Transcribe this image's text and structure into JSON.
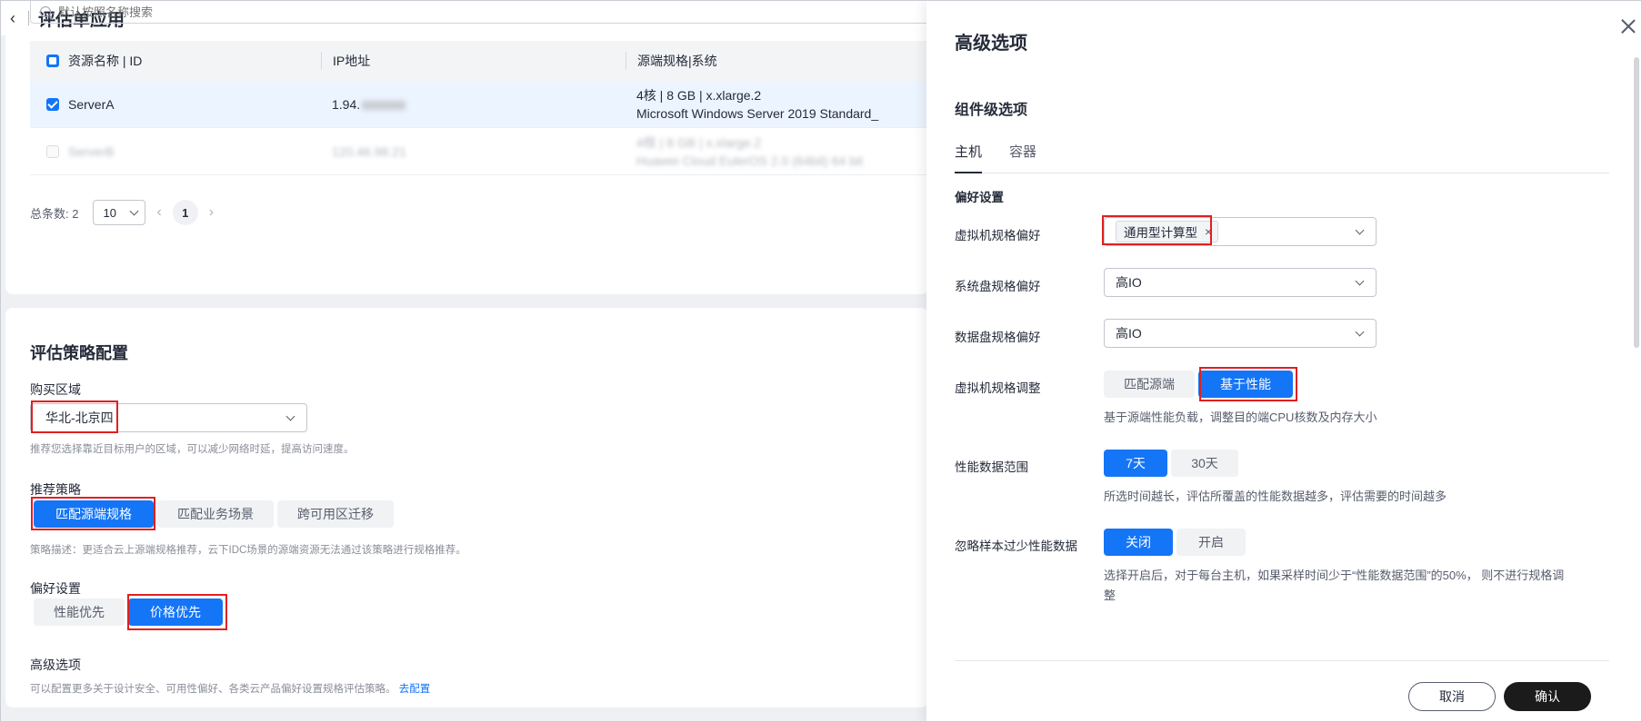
{
  "header": {
    "back_icon": "‹",
    "title": "评估单应用"
  },
  "search": {
    "placeholder": "默认按照名称搜索"
  },
  "table": {
    "columns": [
      "资源名称 | ID",
      "IP地址",
      "源端规格|系统"
    ],
    "rows": [
      {
        "name": "ServerA",
        "ip": "1.94.",
        "spec": "4核 | 8 GB | x.xlarge.2",
        "os": "Microsoft Windows Server 2019 Standard_",
        "checked": true
      },
      {
        "name": "ServerB",
        "ip": "120.46.98.21",
        "spec": "4核 | 8 GB | x.xlarge.2",
        "os": "Huawei Cloud EulerOS 2.0 (64bit) 64 bit",
        "checked": false,
        "blurred": true
      }
    ]
  },
  "pagination": {
    "total_label": "总条数: 2",
    "page_size": "10",
    "current_page": "1",
    "prev_icon": "‹",
    "next_icon": "›"
  },
  "strategy": {
    "title": "评估策略配置",
    "region_label": "购买区域",
    "region_value": "华北-北京四",
    "region_hint": "推荐您选择靠近目标用户的区域，可以减少网络时延，提高访问速度。",
    "policy_label": "推荐策略",
    "policy_options": [
      "匹配源端规格",
      "匹配业务场景",
      "跨可用区迁移"
    ],
    "policy_selected": 0,
    "policy_hint": "策略描述：更适合云上源端规格推荐，云下IDC场景的源端资源无法通过该策略进行规格推荐。",
    "pref_label": "偏好设置",
    "pref_options": [
      "性能优先",
      "价格优先"
    ],
    "pref_selected": 1,
    "adv_label": "高级选项",
    "adv_hint": "可以配置更多关于设计安全、可用性偏好、各类云产品偏好设置规格评估策略。",
    "adv_link": "去配置"
  },
  "drawer": {
    "title": "高级选项",
    "subtitle": "组件级选项",
    "tabs": [
      "主机",
      "容器"
    ],
    "group_label": "偏好设置",
    "vm_pref_label": "虚拟机规格偏好",
    "vm_pref_tag": "通用型计算型",
    "tag_close_icon": "×",
    "sysdisk_label": "系统盘规格偏好",
    "sysdisk_value": "高IO",
    "datadisk_label": "数据盘规格偏好",
    "datadisk_value": "高IO",
    "vm_adjust_label": "虚拟机规格调整",
    "vm_adjust_options": [
      "匹配源端",
      "基于性能"
    ],
    "vm_adjust_selected": 1,
    "vm_adjust_hint": "基于源端性能负载，调整目的端CPU核数及内存大小",
    "perf_range_label": "性能数据范围",
    "perf_range_options": [
      "7天",
      "30天"
    ],
    "perf_range_selected": 0,
    "perf_range_hint": "所选时间越长，评估所覆盖的性能数据越多，评估需要的时间越多",
    "ignore_label": "忽略样本过少性能数据",
    "ignore_options": [
      "关闭",
      "开启"
    ],
    "ignore_selected": 0,
    "ignore_hint_line1": "选择开启后，对于每台主机，如果采样时间少于“性能数据范围”的50%， 则不进行规格调",
    "ignore_hint_line2": "整",
    "cancel_label": "取消",
    "ok_label": "确认"
  },
  "colors": {
    "accent": "#1475f7",
    "highlight_box": "#e02020",
    "selected_row": "#ecf4ff",
    "primary_dark": "#1b1b1b"
  }
}
